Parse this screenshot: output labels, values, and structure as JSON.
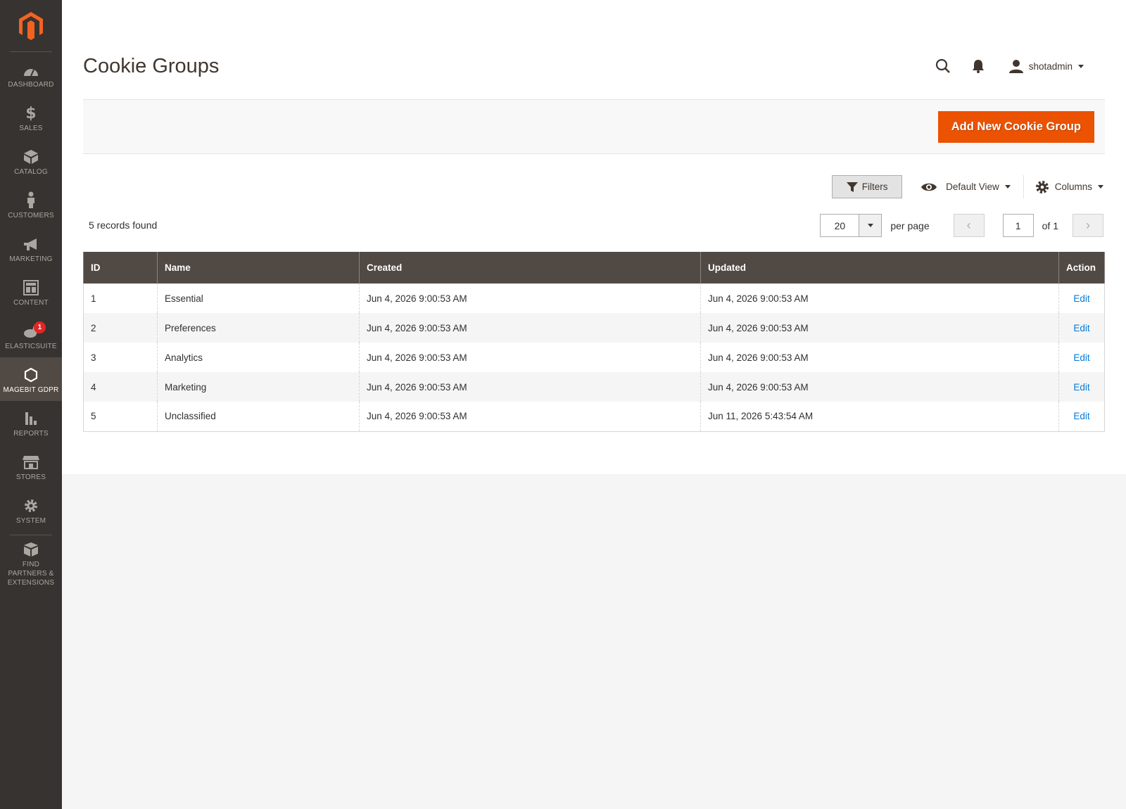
{
  "colors": {
    "sidebar": "#373330",
    "accent": "#eb5202",
    "link": "#007bdb",
    "table_header": "#514943",
    "badge": "#e22626"
  },
  "sidebar": {
    "items": [
      {
        "label": "DASHBOARD",
        "icon": "dashboard-icon"
      },
      {
        "label": "SALES",
        "icon": "dollar-icon"
      },
      {
        "label": "CATALOG",
        "icon": "box-icon"
      },
      {
        "label": "CUSTOMERS",
        "icon": "person-icon"
      },
      {
        "label": "MARKETING",
        "icon": "megaphone-icon"
      },
      {
        "label": "CONTENT",
        "icon": "layout-icon"
      },
      {
        "label": "ELASTICSUITE",
        "icon": "rabbit-icon",
        "badge": "1"
      },
      {
        "label": "MAGEBIT GDPR",
        "icon": "hexagon-icon"
      },
      {
        "label": "REPORTS",
        "icon": "bar-chart-icon"
      },
      {
        "label": "STORES",
        "icon": "store-icon"
      },
      {
        "label": "SYSTEM",
        "icon": "gear-icon"
      },
      {
        "label": "FIND PARTNERS & EXTENSIONS",
        "icon": "cubes-icon"
      }
    ]
  },
  "header": {
    "title": "Cookie Groups",
    "user": "shotadmin"
  },
  "actions": {
    "add_button": "Add New Cookie Group"
  },
  "toolbar": {
    "filters": "Filters",
    "view": "Default View",
    "columns": "Columns"
  },
  "grid": {
    "records_found": "5 records found",
    "per_page_value": "20",
    "per_page_label": "per page",
    "current_page": "1",
    "page_total": "of 1",
    "columns": [
      "ID",
      "Name",
      "Created",
      "Updated",
      "Action"
    ],
    "rows": [
      {
        "id": "1",
        "name": "Essential",
        "created": "Jun 4, 2026 9:00:53 AM",
        "updated": "Jun 4, 2026 9:00:53 AM",
        "action": "Edit"
      },
      {
        "id": "2",
        "name": "Preferences",
        "created": "Jun 4, 2026 9:00:53 AM",
        "updated": "Jun 4, 2026 9:00:53 AM",
        "action": "Edit"
      },
      {
        "id": "3",
        "name": "Analytics",
        "created": "Jun 4, 2026 9:00:53 AM",
        "updated": "Jun 4, 2026 9:00:53 AM",
        "action": "Edit"
      },
      {
        "id": "4",
        "name": "Marketing",
        "created": "Jun 4, 2026 9:00:53 AM",
        "updated": "Jun 4, 2026 9:00:53 AM",
        "action": "Edit"
      },
      {
        "id": "5",
        "name": "Unclassified",
        "created": "Jun 4, 2026 9:00:53 AM",
        "updated": "Jun 11, 2026 5:43:54 AM",
        "action": "Edit"
      }
    ]
  }
}
